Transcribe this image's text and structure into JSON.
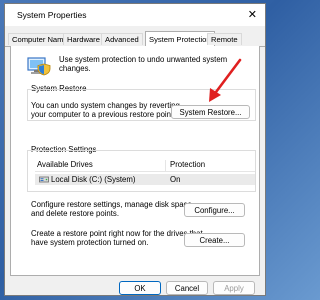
{
  "window": {
    "title": "System Properties",
    "close_glyph": "✕"
  },
  "tabs": [
    {
      "label": "Computer Name"
    },
    {
      "label": "Hardware"
    },
    {
      "label": "Advanced"
    },
    {
      "label": "System Protection",
      "active": true
    },
    {
      "label": "Remote"
    }
  ],
  "info": {
    "icon": "computer-shield-icon",
    "text": "Use system protection to undo unwanted system changes."
  },
  "system_restore": {
    "heading": "System Restore",
    "description_line1": "You can undo system changes by reverting",
    "description_line2": "your computer to a previous restore point.",
    "button_label": "System Restore..."
  },
  "protection_settings": {
    "heading": "Protection Settings",
    "columns": {
      "drives": "Available Drives",
      "protection": "Protection"
    },
    "rows": [
      {
        "icon": "drive-icon",
        "drive": "Local Disk (C:) (System)",
        "protection": "On"
      }
    ]
  },
  "configure": {
    "line1": "Configure restore settings, manage disk space,",
    "line2": "and delete restore points.",
    "button_label": "Configure..."
  },
  "create": {
    "line1": "Create a restore point right now for the drives that",
    "line2": "have system protection turned on.",
    "button_label": "Create..."
  },
  "footer": {
    "ok_label": "OK",
    "cancel_label": "Cancel",
    "apply_label": "Apply"
  },
  "colors": {
    "annotation_arrow": "#e02020",
    "accent": "#0067c0"
  }
}
